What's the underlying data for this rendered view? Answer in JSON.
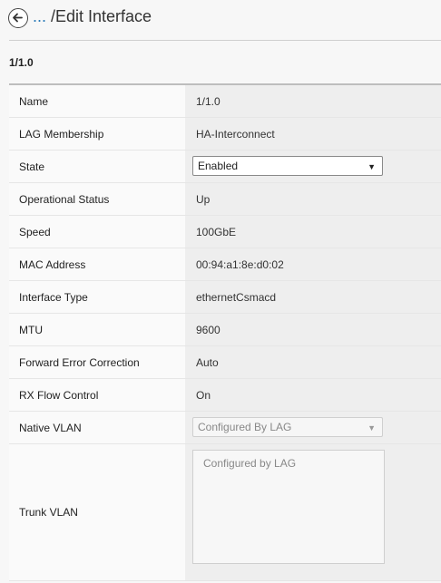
{
  "header": {
    "breadcrumb_dots": "...",
    "title": "/Edit Interface"
  },
  "section": {
    "title": "1/1.0"
  },
  "rows": [
    {
      "label": "Name",
      "value": "1/1.0"
    },
    {
      "label": "LAG Membership",
      "value": "HA-Interconnect"
    },
    {
      "label": "State",
      "value": "Enabled"
    },
    {
      "label": "Operational Status",
      "value": "Up"
    },
    {
      "label": "Speed",
      "value": "100GbE"
    },
    {
      "label": "MAC Address",
      "value": "00:94:a1:8e:d0:02"
    },
    {
      "label": "Interface Type",
      "value": "ethernetCsmacd"
    },
    {
      "label": "MTU",
      "value": "9600"
    },
    {
      "label": "Forward Error Correction",
      "value": "Auto"
    },
    {
      "label": "RX Flow Control",
      "value": "On"
    },
    {
      "label": "Native VLAN",
      "value": "Configured By LAG"
    },
    {
      "label": "Trunk VLAN",
      "value": "Configured by LAG"
    }
  ],
  "icons": {
    "back": "arrow-left-circle-icon",
    "dropdown": "triangle-down-icon"
  }
}
